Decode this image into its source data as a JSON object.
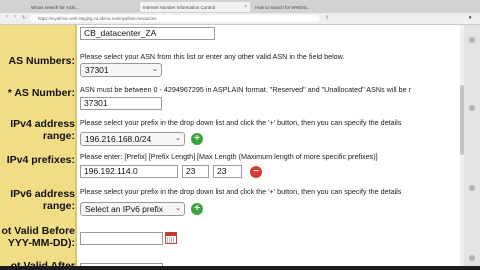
{
  "browser": {
    "tabs": [
      {
        "label": "Whois search for ASN..."
      },
      {
        "label": "Internet Number Information Control"
      },
      {
        "label": "How to search for WHOIS..."
      }
    ],
    "url": "https://myafrinic-web.staging.ca.afrinic.net/myafrinic/resources"
  },
  "form": {
    "asname_value": "CB_datacenter_ZA",
    "as_numbers": {
      "label": "AS Numbers:",
      "help": "Please select your ASN from this list or enter any other valid ASN in the field below.",
      "selected": "37301"
    },
    "as_number": {
      "label": "* AS Number:",
      "help": "ASN must be between 0 - 4294967295 in ASPLAIN format. \"Reserved\" and \"Unallocated\" ASNs will be r",
      "value": "37301"
    },
    "ipv4_range": {
      "label_line1": "IPv4 address",
      "label_line2": "range:",
      "help": "Please select your prefix in the drop down list and click the '+' button, then you can specify the details",
      "selected": "196.216.168.0/24"
    },
    "ipv4_prefixes": {
      "label": "IPv4 prefixes:",
      "help": "Please enter: [Prefix] [Prefix Length] [Max Length (Maximum length of more specific prefixes)]",
      "prefix": "196.192.114.0",
      "length": "23",
      "max_length": "23"
    },
    "ipv6_range": {
      "label_line1": "IPv6 address",
      "label_line2": "range:",
      "help": "Please select your prefix in the drop down list and click the '+' button, then you can specify the details",
      "selected": "Select an IPv6 prefix"
    },
    "not_valid_before": {
      "label_line1": "ot Valid Before",
      "label_line2": "YYY-MM-DD):",
      "value": ""
    },
    "not_valid_after": {
      "label": "ot Valid After"
    }
  },
  "icons": {
    "add": "+",
    "remove": "−",
    "chevron": "⌃"
  }
}
